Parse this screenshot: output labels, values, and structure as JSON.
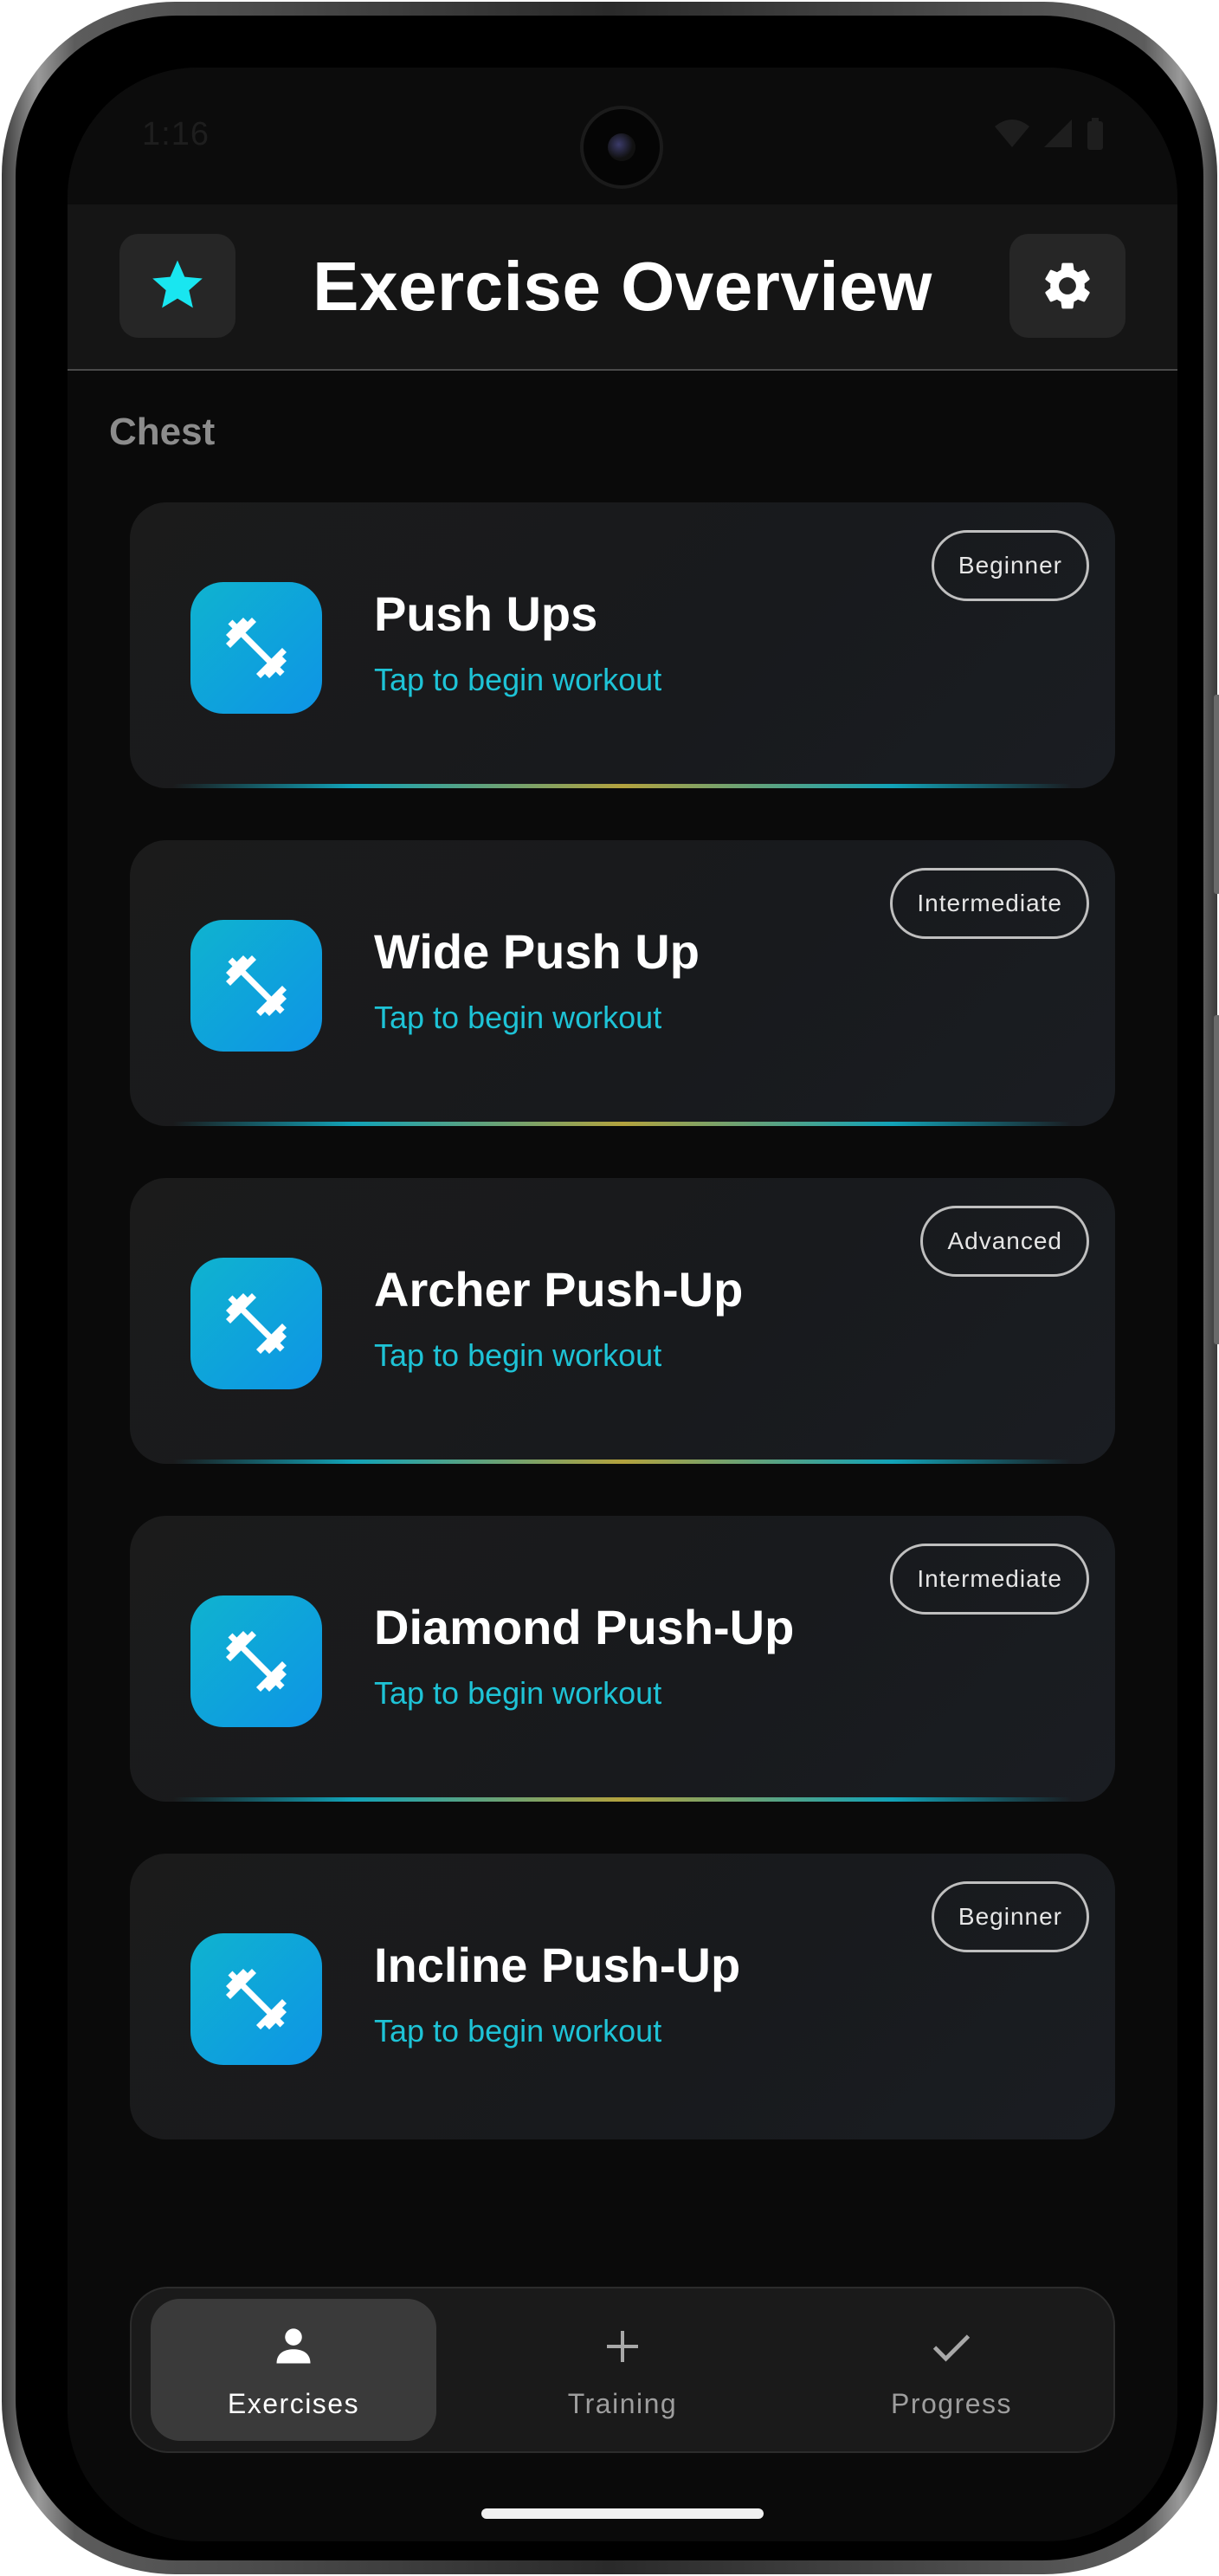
{
  "status_bar": {
    "time": "1:16"
  },
  "header": {
    "title": "Exercise Overview",
    "favorite_icon": "star-icon",
    "settings_icon": "gear-icon"
  },
  "section": {
    "label": "Chest"
  },
  "exercises": [
    {
      "name": "Push Ups",
      "subtitle": "Tap to begin workout",
      "level": "Beginner",
      "icon": "dumbbell-icon"
    },
    {
      "name": "Wide Push Up",
      "subtitle": "Tap to begin workout",
      "level": "Intermediate",
      "icon": "dumbbell-icon"
    },
    {
      "name": "Archer Push-Up",
      "subtitle": "Tap to begin workout",
      "level": "Advanced",
      "icon": "dumbbell-icon"
    },
    {
      "name": "Diamond Push-Up",
      "subtitle": "Tap to begin workout",
      "level": "Intermediate",
      "icon": "dumbbell-icon"
    },
    {
      "name": "Incline Push-Up",
      "subtitle": "Tap to begin workout",
      "level": "Beginner",
      "icon": "dumbbell-icon"
    }
  ],
  "bottom_nav": {
    "items": [
      {
        "label": "Exercises",
        "icon": "person-icon",
        "active": true
      },
      {
        "label": "Training",
        "icon": "plus-icon",
        "active": false
      },
      {
        "label": "Progress",
        "icon": "check-icon",
        "active": false
      }
    ]
  },
  "colors": {
    "accent": "#1ec3d6",
    "star": "#19e6f0",
    "icon_gradient_start": "#0fb3cf",
    "icon_gradient_end": "#0e94e6",
    "background": "#0a0a0a",
    "card": "#1b1b1b"
  }
}
